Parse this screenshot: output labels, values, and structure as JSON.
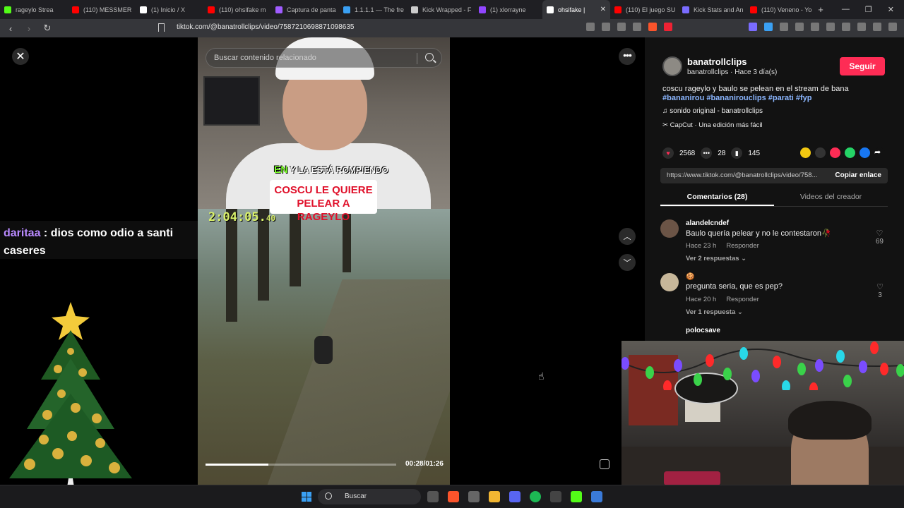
{
  "browser": {
    "tabs": [
      {
        "label": "rageylo Strea",
        "color": "#53fc18"
      },
      {
        "label": "(110) MESSMER",
        "color": "#ff0000"
      },
      {
        "label": "(1) Inicio / X",
        "color": "#ffffff"
      },
      {
        "label": "(110) ohsifake m",
        "color": "#ff0000"
      },
      {
        "label": "Captura de panta",
        "color": "#a05cff"
      },
      {
        "label": "1.1.1.1 — The fre",
        "color": "#3aa0f3"
      },
      {
        "label": "Kick Wrapped - F",
        "color": "#cccccc"
      },
      {
        "label": "(1) xlorrayne",
        "color": "#9146ff"
      },
      {
        "label": "ohsifake |",
        "color": "#ffffff",
        "active": true
      },
      {
        "label": "(110) El juego SU",
        "color": "#ff0000"
      },
      {
        "label": "Kick Stats and An",
        "color": "#7a6cff"
      },
      {
        "label": "(110) Veneno - Yo",
        "color": "#ff0000"
      }
    ],
    "new_tab": "+",
    "url": "tiktok.com/@banatrollclips/video/7587210698871098635",
    "window_controls": [
      "—",
      "❐",
      "✕"
    ]
  },
  "video": {
    "search_placeholder": "Buscar contenido relacionado",
    "caption_prefix": "EN",
    "caption_line1": "Y LA ESTÁ ROMPIENDO",
    "caption_line2": "COSCU LE QUIERE",
    "caption_line3": "PELEAR A RAGEYLO",
    "timer_main": "2:04:05.",
    "timer_frac": "40",
    "time_display": "00:28/01:26",
    "progress": 0.33
  },
  "chat": {
    "user": "daritaa",
    "separator": " : ",
    "message": "dios como odio a santi caseres"
  },
  "post": {
    "username": "banatrollclips",
    "subline": "banatrollclips · Hace 3 día(s)",
    "follow_label": "Seguir",
    "description": "coscu rageylo y baulo se pelean en el stream de bana",
    "hashtags": "#bananirou #bananirouclips #parati #fyp",
    "sound": "sonido original - banatrollclips",
    "capcut": "CapCut · Una edición más fácil",
    "likes": "2568",
    "comments": "28",
    "saves": "145",
    "link": "https://www.tiktok.com/@banatrollclips/video/758...",
    "copy_label": "Copiar enlace",
    "tab_comments": "Comentarios (28)",
    "tab_creator": "Videos del creador"
  },
  "comments": [
    {
      "user": "alandelcndef",
      "text": "Baulo quería pelear y no le contestaron🥀",
      "time": "Hace 23 h",
      "reply": "Responder",
      "replies": "Ver 2 respuestas ⌄",
      "likes": "69"
    },
    {
      "user": "🍪",
      "text": "pregunta seria, que es pep?",
      "time": "Hace 20 h",
      "reply": "Responder",
      "replies": "Ver 1 respuesta ⌄",
      "likes": "3"
    },
    {
      "user": "polocsave",
      "text": "",
      "time": "",
      "reply": "",
      "replies": "",
      "likes": ""
    }
  ],
  "taskbar": {
    "search_label": "Buscar"
  },
  "colors": {
    "accent": "#fe2c55",
    "hashtag": "#8bb6ff",
    "timer": "#d8f06a",
    "chat_user": "#b98aff"
  }
}
